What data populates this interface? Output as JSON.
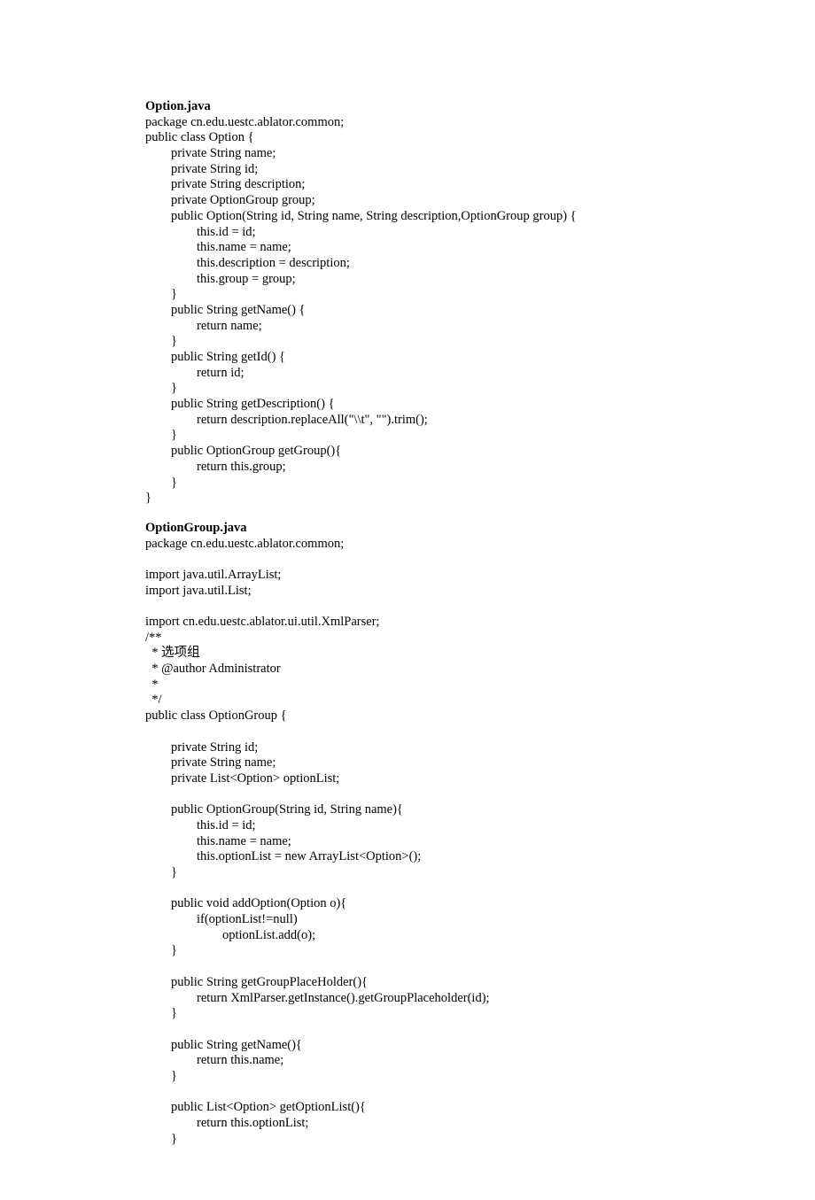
{
  "file1": {
    "name": "Option.java",
    "code": "package cn.edu.uestc.ablator.common;\npublic class Option {\n        private String name;\n        private String id;\n        private String description;\n        private OptionGroup group;\n        public Option(String id, String name, String description,OptionGroup group) {\n                this.id = id;\n                this.name = name;\n                this.description = description;\n                this.group = group;\n        }\n        public String getName() {\n                return name;\n        }\n        public String getId() {\n                return id;\n        }\n        public String getDescription() {\n                return description.replaceAll(\"\\\\t\", \"\").trim();\n        }\n        public OptionGroup getGroup(){\n                return this.group;\n        }\n}"
  },
  "file2": {
    "name": "OptionGroup.java",
    "code": "package cn.edu.uestc.ablator.common;\n\nimport java.util.ArrayList;\nimport java.util.List;\n\nimport cn.edu.uestc.ablator.ui.util.XmlParser;\n/**\n  * 选项组\n  * @author Administrator\n  *\n  */\npublic class OptionGroup {\n\n        private String id;\n        private String name;\n        private List<Option> optionList;\n\n        public OptionGroup(String id, String name){\n                this.id = id;\n                this.name = name;\n                this.optionList = new ArrayList<Option>();\n        }\n\n        public void addOption(Option o){\n                if(optionList!=null)\n                        optionList.add(o);\n        }\n\n        public String getGroupPlaceHolder(){\n                return XmlParser.getInstance().getGroupPlaceholder(id);\n        }\n\n        public String getName(){\n                return this.name;\n        }\n\n        public List<Option> getOptionList(){\n                return this.optionList;\n        }"
  }
}
